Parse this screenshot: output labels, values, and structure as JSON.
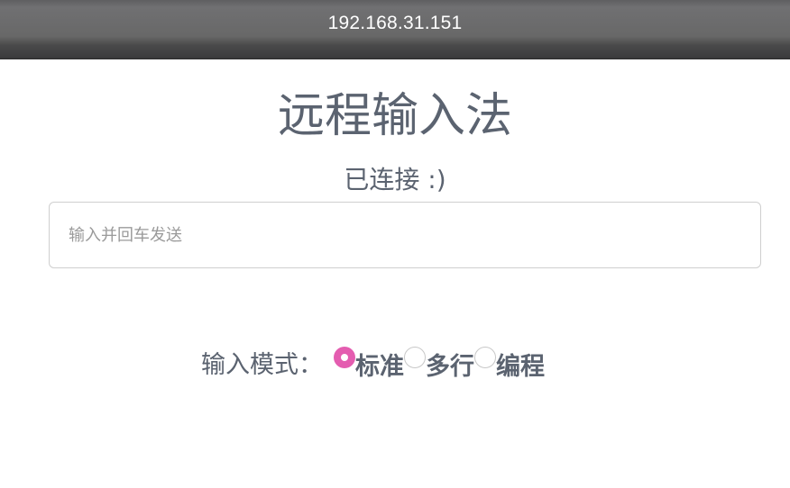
{
  "window": {
    "address": "192.168.31.151"
  },
  "page": {
    "title": "远程输入法",
    "status": "已连接 :)"
  },
  "input": {
    "placeholder": "输入并回车发送",
    "value": ""
  },
  "mode": {
    "label": "输入模式：",
    "selected": "标准",
    "options": [
      {
        "label": "标准",
        "checked": true
      },
      {
        "label": "多行",
        "checked": false
      },
      {
        "label": "编程",
        "checked": false
      }
    ]
  },
  "colors": {
    "accent": "#e45db0",
    "text": "#5b6370"
  }
}
